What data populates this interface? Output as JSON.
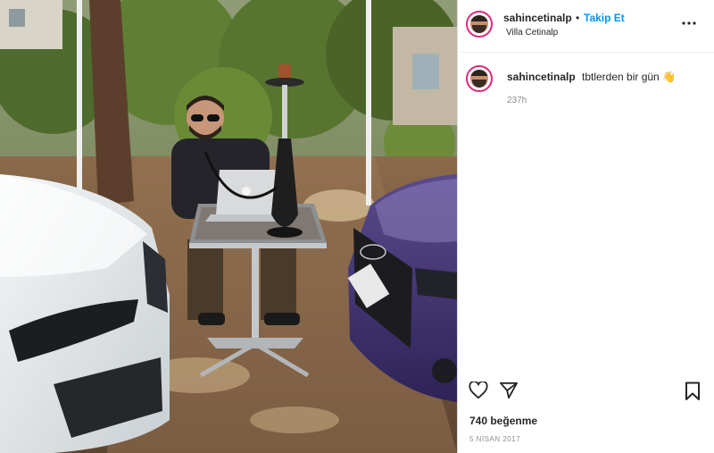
{
  "post": {
    "author": {
      "username": "sahincetinalp",
      "follow_label": "Takip Et",
      "separator": "•",
      "location": "Villa Cetinalp"
    },
    "more_icon": "more-horizontal-icon",
    "caption": {
      "username": "sahincetinalp",
      "text": "tbtlerden bir gün 👋",
      "time_ago": "237h"
    },
    "actions": {
      "like_icon": "heart-icon",
      "share_icon": "send-icon",
      "save_icon": "bookmark-icon"
    },
    "likes": "740 beğenme",
    "date": "5 NİSAN 2017"
  },
  "colors": {
    "follow_blue": "#0095f6",
    "text": "#262626",
    "muted": "#8e8e8e",
    "story_ring": "#e0287a"
  }
}
